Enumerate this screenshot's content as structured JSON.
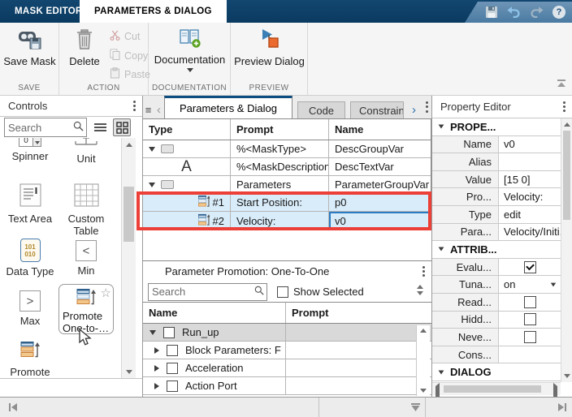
{
  "colors": {
    "titlebar_blue": "#0e3e66",
    "active_tab_accent": "#0d4d80",
    "selection_blue": "#d9ecf9",
    "annotation_red": "#ec3f38",
    "editing_cell_border": "#2b7cc2",
    "promote_orange": "#f3c68a",
    "doc_icon_green": "#5aa21e"
  },
  "icons": {
    "help_glyph": "?",
    "menu_glyph": "≡",
    "chevron_left_glyph": "‹",
    "chevron_right_glyph": "›",
    "star_glyph": "☆",
    "letter_a_glyph": "A",
    "min_glyph": "<",
    "max_glyph": ">",
    "spinner_glyph": "0",
    "data_type_top": "101",
    "data_type_bottom": "010"
  },
  "titlebar": {
    "tabs": [
      {
        "label": "MASK EDITOR"
      },
      {
        "label": "PARAMETERS & DIALOG"
      }
    ]
  },
  "ribbon": {
    "save_mask": "Save Mask",
    "delete": "Delete",
    "cut": "Cut",
    "copy": "Copy",
    "paste": "Paste",
    "documentation": "Documentation",
    "preview_dialog": "Preview Dialog",
    "sections": {
      "save": "SAVE",
      "action": "ACTION",
      "documentation": "DOCUMENTATION",
      "preview": "PREVIEW"
    }
  },
  "controls_panel": {
    "title": "Controls",
    "search_placeholder": "Search",
    "items": [
      {
        "label": "Spinner"
      },
      {
        "label": "Unit"
      },
      {
        "label": "Text Area"
      },
      {
        "label": "Custom Table"
      },
      {
        "label": "Data Type"
      },
      {
        "label": "Min"
      },
      {
        "label": "Max"
      },
      {
        "label": "Promote One-to-…",
        "highlighted": true
      },
      {
        "label": "Promote"
      }
    ]
  },
  "editor_area": {
    "tabs": [
      {
        "label": "Parameters & Dialog",
        "active": true
      },
      {
        "label": "Code",
        "active": false
      },
      {
        "label": "Constraints",
        "active": false
      }
    ],
    "table": {
      "columns": [
        "Type",
        "Prompt",
        "Name"
      ],
      "rows": [
        {
          "prompt": "%<MaskType>",
          "name": "DescGroupVar",
          "expanded": true
        },
        {
          "prompt": "%<MaskDescription>",
          "name": "DescTextVar"
        },
        {
          "prompt": "Parameters",
          "name": "ParameterGroupVar",
          "expanded": true
        },
        {
          "index_label": "#1",
          "prompt": "Start Position:",
          "name": "p0",
          "selected": true
        },
        {
          "index_label": "#2",
          "prompt": "Velocity:",
          "name": "v0",
          "selected": true,
          "editing": true
        }
      ]
    }
  },
  "promotion_panel": {
    "title": "Parameter Promotion: One-To-One",
    "search_placeholder": "Search",
    "show_selected_label": "Show Selected",
    "show_selected_checked": false,
    "columns": [
      "Name",
      "Prompt"
    ],
    "rows": [
      {
        "label": "Run_up",
        "expanded": true,
        "checked": false,
        "selected": true
      },
      {
        "label": "Block Parameters: F",
        "expanded": false,
        "checked": false
      },
      {
        "label": "Acceleration",
        "expanded": false,
        "checked": false
      },
      {
        "label": "Action Port",
        "expanded": false,
        "checked": false
      }
    ]
  },
  "property_editor": {
    "title": "Property Editor",
    "rows": [
      {
        "kind": "section",
        "label": "PROPE..."
      },
      {
        "label": "Name",
        "value": "v0"
      },
      {
        "label": "Alias",
        "value": ""
      },
      {
        "label": "Value",
        "value": "[15 0]"
      },
      {
        "label": "Pro...",
        "value": "Velocity:"
      },
      {
        "label": "Type",
        "value": "edit"
      },
      {
        "label": "Para...",
        "value": "Velocity/Initi.."
      },
      {
        "kind": "section",
        "label": "ATTRIB..."
      },
      {
        "label": "Evalu...",
        "checkbox": true,
        "checked": true
      },
      {
        "label": "Tuna...",
        "value": "on",
        "dropdown": true
      },
      {
        "label": "Read...",
        "checkbox": true,
        "checked": false
      },
      {
        "label": "Hidd...",
        "checkbox": true,
        "checked": false
      },
      {
        "label": "Neve...",
        "checkbox": true,
        "checked": false
      },
      {
        "label": "Cons...",
        "value": ""
      },
      {
        "kind": "section",
        "label": "DIALOG"
      }
    ]
  }
}
